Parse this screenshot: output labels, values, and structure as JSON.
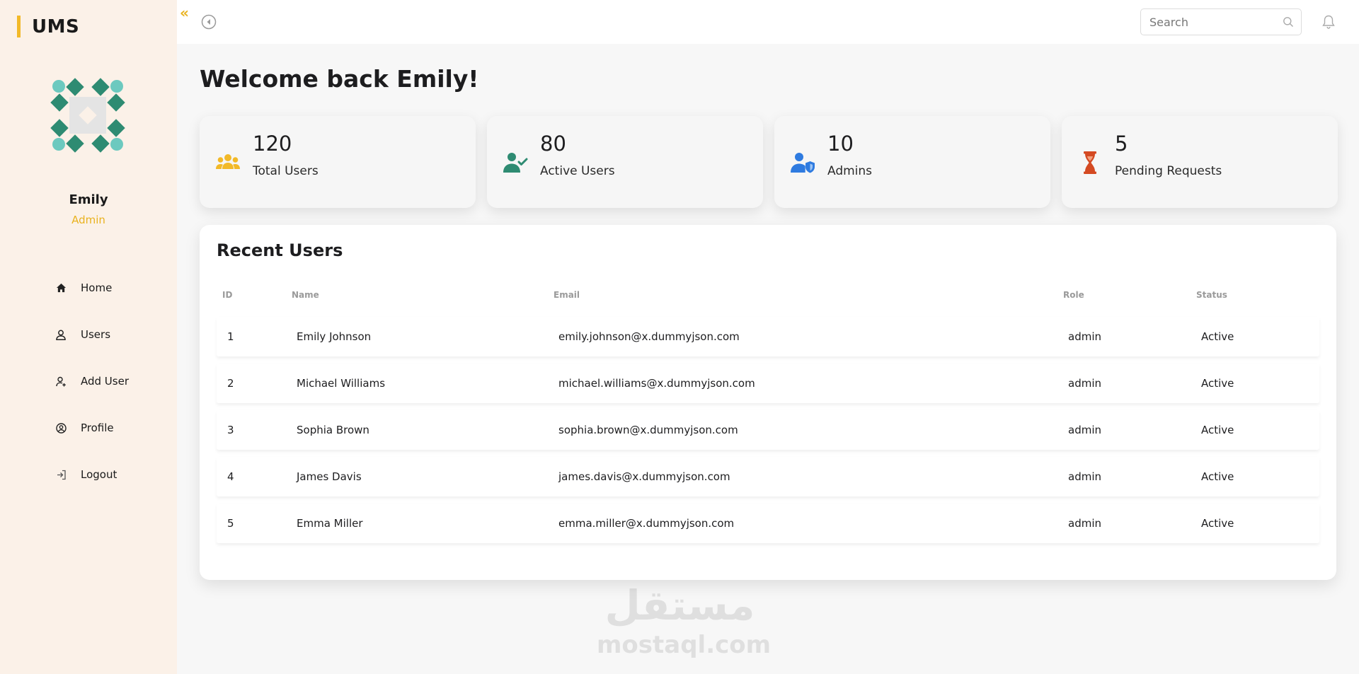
{
  "app": {
    "brand": "UMS"
  },
  "sidebar": {
    "user": {
      "name": "Emily",
      "role": "Admin"
    },
    "items": [
      {
        "label": "Home",
        "icon": "home-icon"
      },
      {
        "label": "Users",
        "icon": "user-icon"
      },
      {
        "label": "Add User",
        "icon": "add-user-icon"
      },
      {
        "label": "Profile",
        "icon": "profile-icon"
      },
      {
        "label": "Logout",
        "icon": "logout-icon"
      }
    ]
  },
  "topbar": {
    "search_placeholder": "Search"
  },
  "main": {
    "welcome": "Welcome back Emily!",
    "cards": [
      {
        "value": "120",
        "label": "Total Users",
        "icon": "users-group-icon",
        "color": "#f2b928"
      },
      {
        "value": "80",
        "label": "Active Users",
        "icon": "user-check-icon",
        "color": "#2e8b72"
      },
      {
        "value": "10",
        "label": "Admins",
        "icon": "user-shield-icon",
        "color": "#2f7be0"
      },
      {
        "value": "5",
        "label": "Pending Requests",
        "icon": "hourglass-icon",
        "color": "#d44a22"
      }
    ],
    "recent": {
      "title": "Recent Users",
      "columns": [
        "ID",
        "Name",
        "Email",
        "Role",
        "Status"
      ],
      "rows": [
        {
          "id": "1",
          "name": "Emily Johnson",
          "email": "emily.johnson@x.dummyjson.com",
          "role": "admin",
          "status": "Active"
        },
        {
          "id": "2",
          "name": "Michael Williams",
          "email": "michael.williams@x.dummyjson.com",
          "role": "admin",
          "status": "Active"
        },
        {
          "id": "3",
          "name": "Sophia Brown",
          "email": "sophia.brown@x.dummyjson.com",
          "role": "admin",
          "status": "Active"
        },
        {
          "id": "4",
          "name": "James Davis",
          "email": "james.davis@x.dummyjson.com",
          "role": "admin",
          "status": "Active"
        },
        {
          "id": "5",
          "name": "Emma Miller",
          "email": "emma.miller@x.dummyjson.com",
          "role": "admin",
          "status": "Active"
        }
      ]
    }
  },
  "watermark": {
    "arabic": "مستقل",
    "latin": "mostaql.com"
  },
  "colors": {
    "accent": "#f2b928",
    "sidebar_bg": "#fbf1e8",
    "teal": "#2e8b72"
  }
}
